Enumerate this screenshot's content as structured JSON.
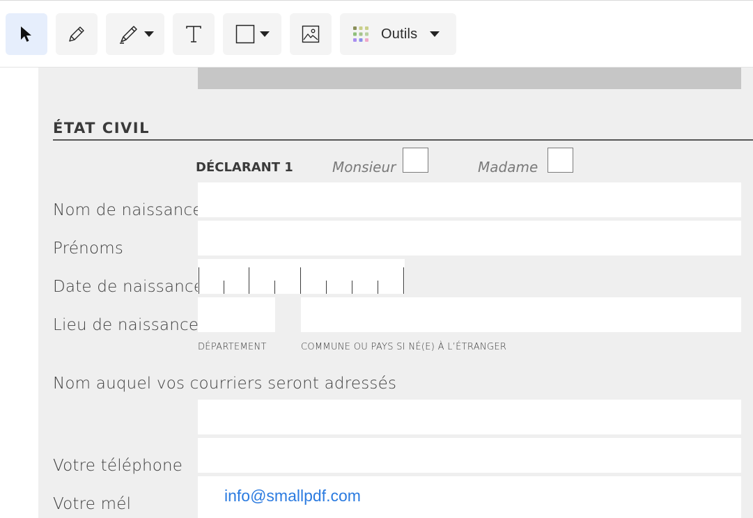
{
  "toolbar": {
    "tools": [
      {
        "id": "select",
        "icon": "cursor-arrow-icon",
        "active": true
      },
      {
        "id": "pencil",
        "icon": "pencil-icon"
      },
      {
        "id": "highlighter",
        "icon": "highlighter-icon",
        "has_dropdown": true
      },
      {
        "id": "text",
        "icon": "text-t-icon"
      },
      {
        "id": "shape",
        "icon": "rectangle-icon",
        "has_dropdown": true
      },
      {
        "id": "image",
        "icon": "image-icon"
      },
      {
        "id": "outils",
        "icon": "apps-grid-icon",
        "has_dropdown": true
      }
    ],
    "outils_label": "Outils"
  },
  "colors": {
    "accent_active_bg": "#e6eefc",
    "page_bg": "#efefef",
    "filled_text": "#2b7be0",
    "grid_dots": [
      "#8a8f5a",
      "#c9cf8a",
      "#c9cf8a",
      "#8fbf7a",
      "#a6c38d",
      "#b9d0a0",
      "#a98ef0",
      "#8a8fe8",
      "#f0a8c8"
    ]
  },
  "form": {
    "section_title": "ÉTAT CIVIL",
    "declarant_label": "DÉCLARANT 1",
    "gender_options": {
      "monsieur": "Monsieur",
      "madame": "Madame"
    },
    "fields": {
      "nom_naissance": {
        "label": "Nom de naissance",
        "value": ""
      },
      "prenoms": {
        "label": "Prénoms",
        "value": ""
      },
      "date_naissance": {
        "label": "Date de naissance",
        "value": ""
      },
      "lieu_naissance": {
        "label": "Lieu de naissance",
        "departement": "",
        "commune": ""
      },
      "nom_courrier": {
        "label": "Nom auquel vos courriers seront adressés",
        "value": ""
      },
      "telephone": {
        "label": "Votre téléphone",
        "value": ""
      },
      "mel": {
        "label": "Votre mél",
        "value": "info@smallpdf.com"
      }
    },
    "sub_labels": {
      "departement": "DÉPARTEMENT",
      "commune": "COMMUNE OU PAYS SI NÉ(E) À L’ÉTRANGER"
    }
  }
}
